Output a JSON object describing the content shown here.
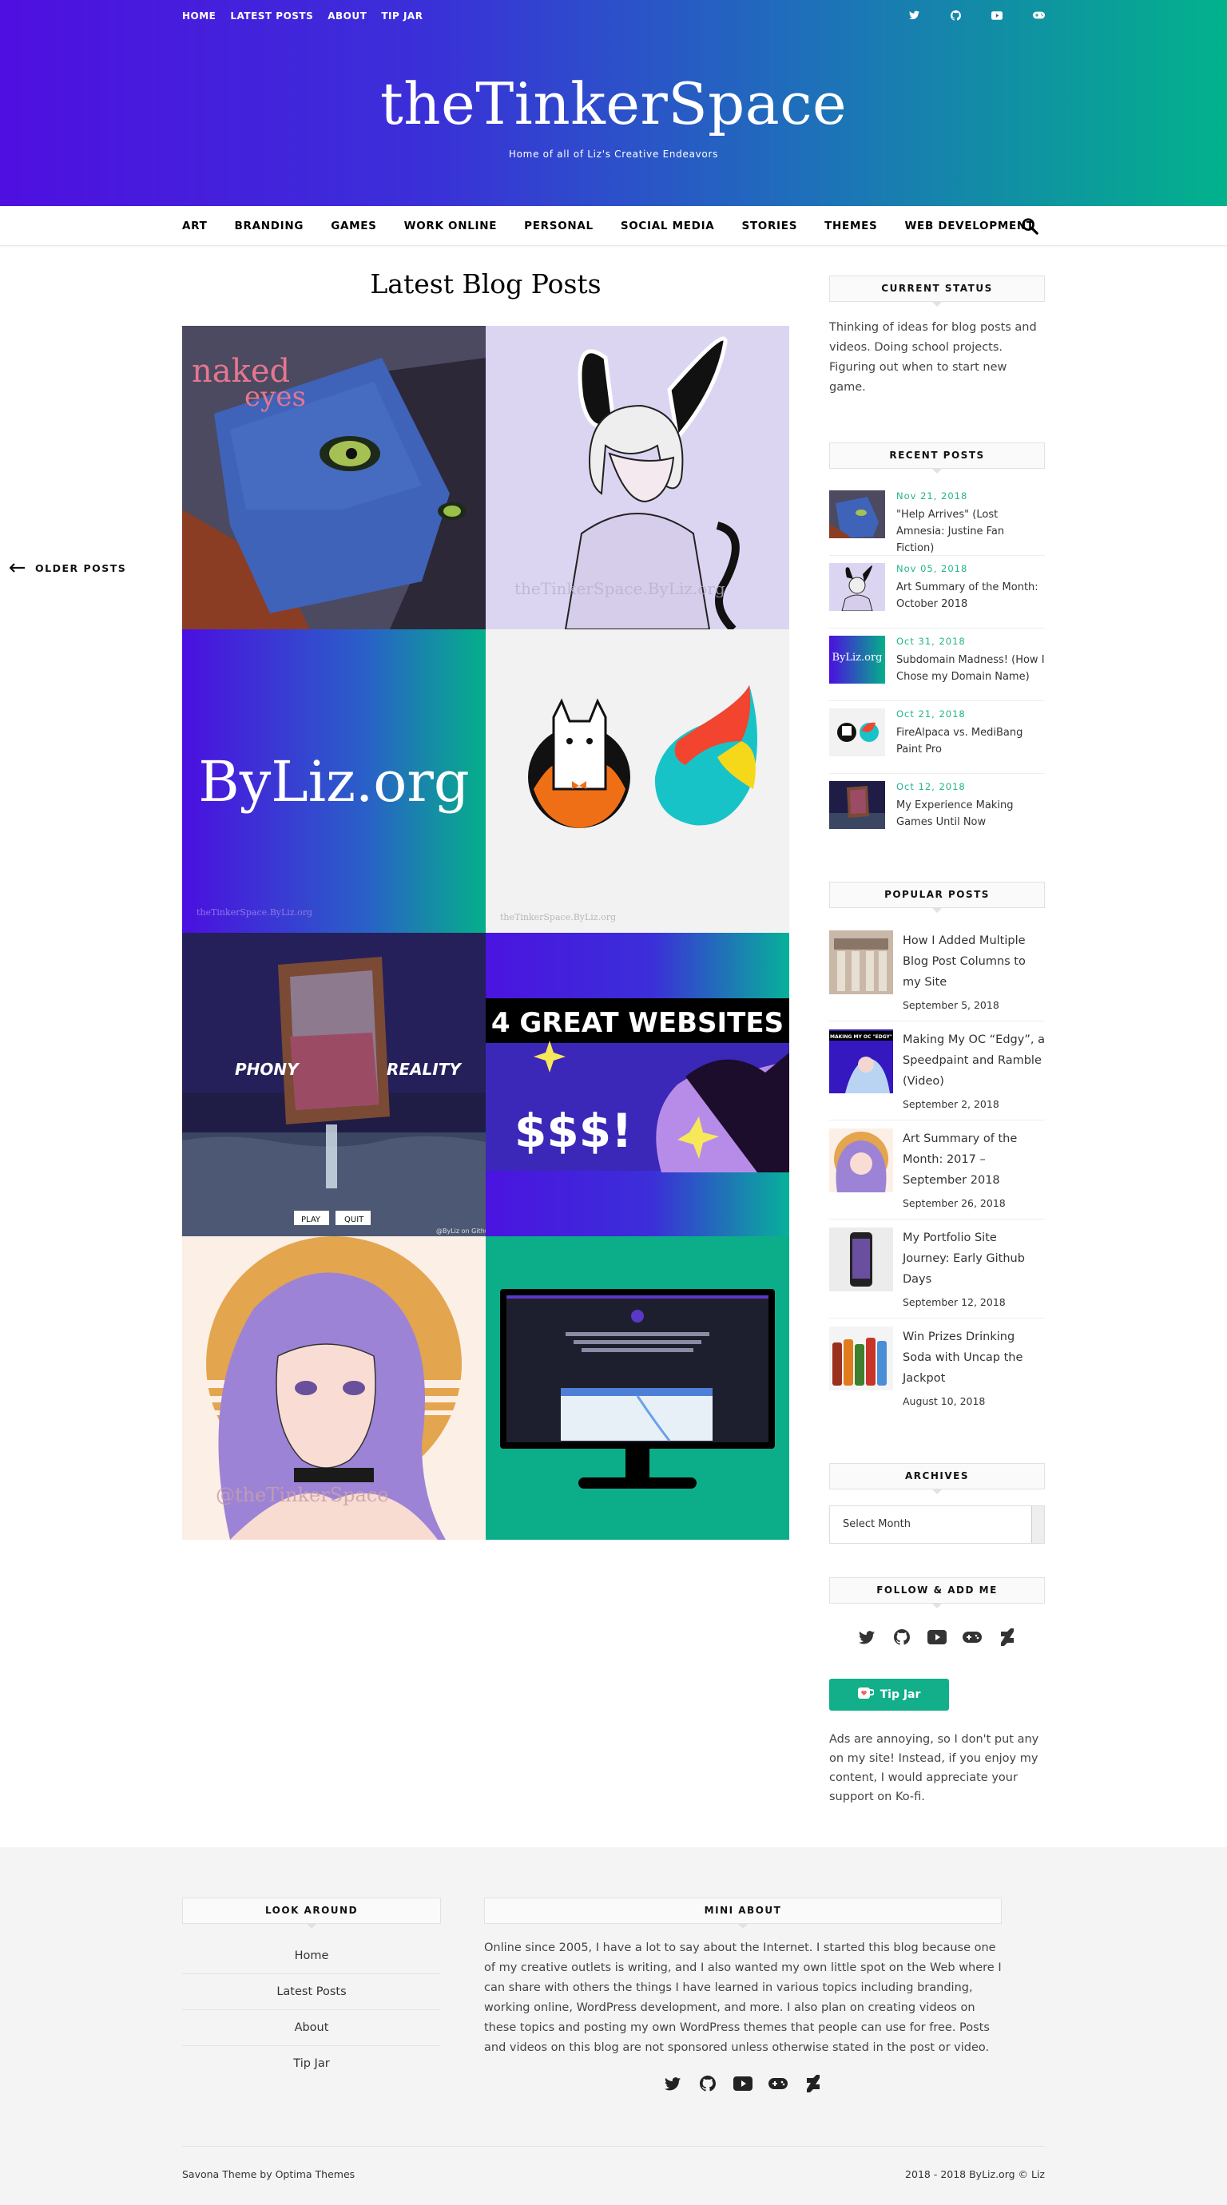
{
  "header": {
    "top_nav": [
      "HOME",
      "LATEST POSTS",
      "ABOUT",
      "TIP JAR"
    ],
    "social_icons": [
      "twitter-icon",
      "github-icon",
      "youtube-icon",
      "gamepad-icon"
    ],
    "site_title": "theTinkerSpace",
    "tagline": "Home of all of Liz's Creative Endeavors",
    "gradient": [
      "#4f0fe0",
      "#02b28c"
    ]
  },
  "category_nav": {
    "items": [
      "ART",
      "BRANDING",
      "GAMES",
      "WORK ONLINE",
      "PERSONAL",
      "SOCIAL MEDIA",
      "STORIES",
      "THEMES",
      "WEB DEVELOPMENT"
    ],
    "search_icon": "search-icon"
  },
  "main": {
    "heading": "Latest Blog Posts",
    "older_posts": "OLDER POSTS",
    "tiles": {
      "naked_eyes_text": "naked\neyes",
      "byliz_text": "ByLiz.org",
      "watermark1": "theTinkerSpace.ByLiz.org",
      "watermark2": "theTinkerSpace.ByLiz.org",
      "watermark3": "theTinkerSpace.ByLiz.org",
      "phony": "PHONY",
      "reality": "REALITY",
      "play": "PLAY",
      "quit": "QUIT",
      "game_wm": "@ByLiz on Github",
      "websites_banner": "4 GREAT WEBSITES",
      "money": "$$$!",
      "art_wm": "@theTinkerSpace"
    }
  },
  "sidebar": {
    "status": {
      "title": "CURRENT STATUS",
      "text": "Thinking of ideas for blog posts and videos. Doing school projects. Figuring out when to start new game."
    },
    "recent": {
      "title": "RECENT POSTS",
      "items": [
        {
          "date": "Nov 21, 2018",
          "title": "\"Help Arrives\" (Lost Amnesia: Justine Fan Fiction)"
        },
        {
          "date": "Nov 05, 2018",
          "title": "Art Summary of the Month: October 2018"
        },
        {
          "date": "Oct 31, 2018",
          "title": "Subdomain Madness! (How I Chose my Domain Name)"
        },
        {
          "date": "Oct 21, 2018",
          "title": "FireAlpaca vs. MediBang Paint Pro"
        },
        {
          "date": "Oct 12, 2018",
          "title": "My Experience Making Games Until Now"
        }
      ],
      "thumb_text": "ByLiz.org"
    },
    "popular": {
      "title": "POPULAR POSTS",
      "items": [
        {
          "title": "How I Added Multiple Blog Post Columns to my Site",
          "date": "September 5, 2018"
        },
        {
          "title": "Making My OC “Edgy”, a Speedpaint and Ramble (Video)",
          "date": "September 2, 2018"
        },
        {
          "title": "Art Summary of the Month: 2017 – September 2018",
          "date": "September 26, 2018"
        },
        {
          "title": "My Portfolio Site Journey: Early Github Days",
          "date": "September 12, 2018"
        },
        {
          "title": "Win Prizes Drinking Soda with Uncap the Jackpot",
          "date": "August 10, 2018"
        }
      ],
      "thumb_text": "MAKING MY OC \"EDGY\""
    },
    "archives": {
      "title": "ARCHIVES",
      "selected": "Select Month"
    },
    "follow": {
      "title": "FOLLOW & ADD ME",
      "icons": [
        "twitter-icon",
        "github-icon",
        "youtube-icon",
        "gamepad-icon",
        "deviantart-icon"
      ]
    },
    "tip_button": "Tip Jar",
    "tip_note": "Ads are annoying, so I don't put any on my site! Instead, if you enjoy my content, I would appreciate your support on Ko-fi."
  },
  "footer": {
    "look_title": "LOOK AROUND",
    "links": [
      "Home",
      "Latest Posts",
      "About",
      "Tip Jar"
    ],
    "about_title": "MINI ABOUT",
    "about_text": "Online since 2005, I have a lot to say about the Internet. I started this blog because one of my creative outlets is writing, and I also wanted my own little spot on the Web where I can share with others the things I have learned in various topics including branding, working online, WordPress development, and more. I also plan on creating videos on these topics and posting my own WordPress themes that people can use for free. Posts and videos on this blog are not sponsored unless otherwise stated in the post or video.",
    "credit": "Savona Theme by Optima Themes",
    "copyright": "2018 - 2018 ByLiz.org © Liz"
  },
  "colors": {
    "accent": "#13ae8a",
    "date_green": "#23b38c"
  }
}
